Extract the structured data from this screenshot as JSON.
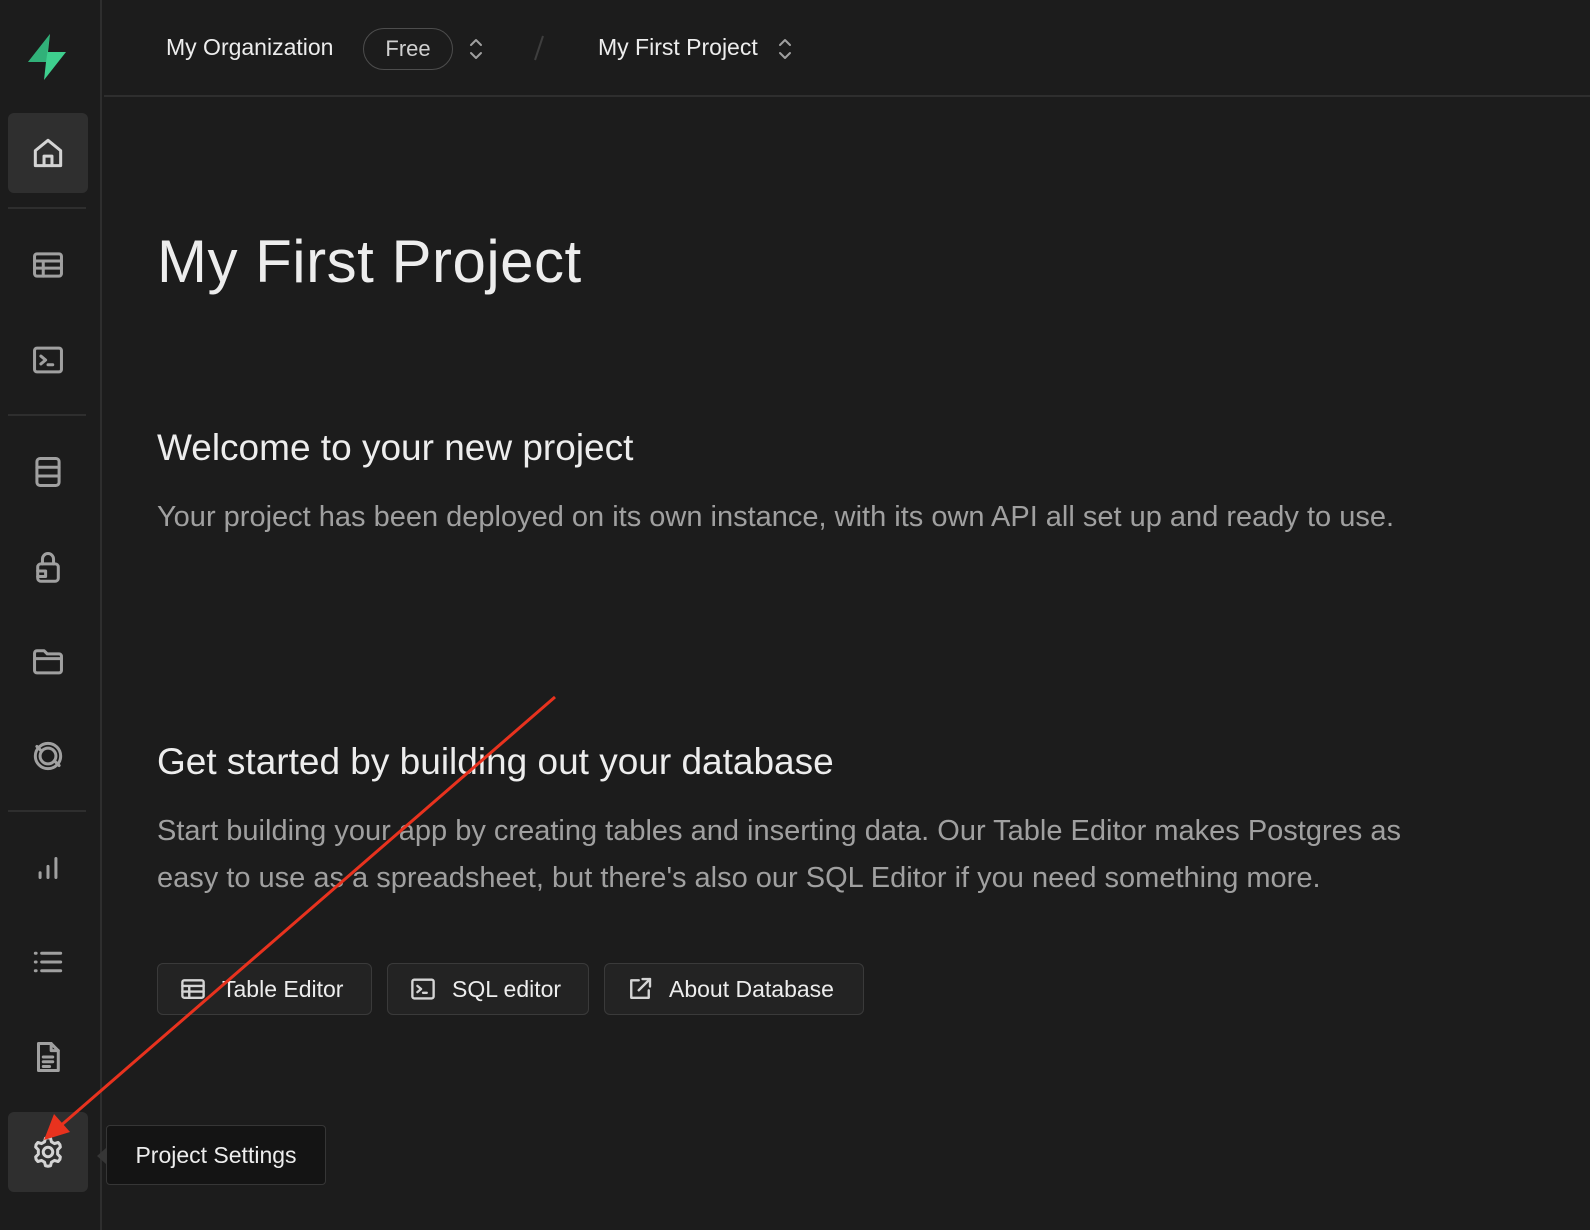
{
  "topbar": {
    "org_name": "My Organization",
    "plan_badge": "Free",
    "project_name": "My First Project"
  },
  "sidebar": {
    "items": [
      {
        "name": "home",
        "icon": "home-icon",
        "active": true
      },
      {
        "name": "table-editor",
        "icon": "table-icon"
      },
      {
        "name": "sql-editor",
        "icon": "terminal-icon"
      },
      {
        "name": "database",
        "icon": "database-icon"
      },
      {
        "name": "authentication",
        "icon": "lock-icon"
      },
      {
        "name": "storage",
        "icon": "folder-icon"
      },
      {
        "name": "realtime",
        "icon": "realtime-icon"
      },
      {
        "name": "reports",
        "icon": "bar-chart-icon"
      },
      {
        "name": "logs",
        "icon": "list-icon"
      },
      {
        "name": "api-docs",
        "icon": "document-icon"
      },
      {
        "name": "project-settings",
        "icon": "gear-icon",
        "active": true
      }
    ],
    "tooltip": "Project Settings"
  },
  "main": {
    "title": "My First Project",
    "welcome_heading": "Welcome to your new project",
    "welcome_text": "Your project has been deployed on its own instance, with its own API all set up and ready to use.",
    "db_heading": "Get started by building out your database",
    "db_text_line1": "Start building your app by creating tables and inserting data. Our Table Editor makes Postgres as",
    "db_text_line2": "easy to use as a spreadsheet, but there's also our SQL Editor if you need something more.",
    "buttons": {
      "table_editor": "Table Editor",
      "sql_editor": "SQL editor",
      "about_database": "About Database"
    }
  },
  "colors": {
    "background": "#1c1c1c",
    "brand_green": "#3ecf8e",
    "annotation_arrow": "#e8321e"
  }
}
